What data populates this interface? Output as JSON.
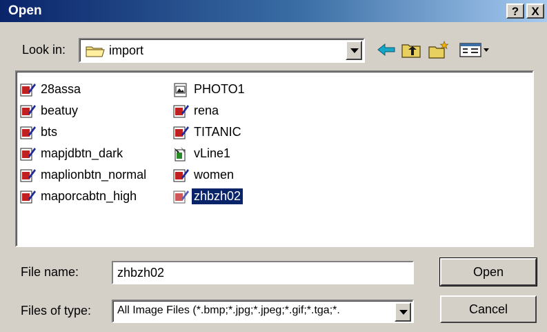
{
  "window": {
    "title": "Open",
    "help_label": "?",
    "close_label": "X"
  },
  "lookin": {
    "label": "Look in:",
    "value": "import",
    "folder_icon": "folder-icon"
  },
  "toolbar": {
    "icons": [
      "back-arrow-icon",
      "up-one-level-icon",
      "new-folder-icon",
      "views-menu-icon"
    ]
  },
  "files": {
    "column1": [
      {
        "name": "28assa",
        "icon": "image-file-icon",
        "selected": false
      },
      {
        "name": "beatuy",
        "icon": "image-file-icon",
        "selected": false
      },
      {
        "name": "bts",
        "icon": "image-file-icon",
        "selected": false
      },
      {
        "name": "mapjdbtn_dark",
        "icon": "image-file-icon",
        "selected": false
      },
      {
        "name": "maplionbtn_normal",
        "icon": "image-file-icon",
        "selected": false
      },
      {
        "name": "maporcabtn_high",
        "icon": "image-file-icon",
        "selected": false
      }
    ],
    "column2": [
      {
        "name": "PHOTO1",
        "icon": "photo-file-icon",
        "selected": false
      },
      {
        "name": "rena",
        "icon": "image-file-icon",
        "selected": false
      },
      {
        "name": "TITANIC",
        "icon": "image-file-icon",
        "selected": false
      },
      {
        "name": "vLine1",
        "icon": "vector-file-icon",
        "selected": false
      },
      {
        "name": "women",
        "icon": "image-file-icon",
        "selected": false
      },
      {
        "name": "zhbzh02",
        "icon": "image-file-icon",
        "selected": true
      }
    ]
  },
  "filename": {
    "label": "File name:",
    "value": "zhbzh02"
  },
  "filetype": {
    "label": "Files of type:",
    "value": "All Image Files (*.bmp;*.jpg;*.jpeg;*.gif;*.tga;*."
  },
  "buttons": {
    "open": "Open",
    "cancel": "Cancel"
  },
  "colors": {
    "title_bar_start": "#0a246a",
    "title_bar_end": "#a6caf0",
    "dialog_bg": "#d4d0c8",
    "selection": "#0a246a"
  }
}
